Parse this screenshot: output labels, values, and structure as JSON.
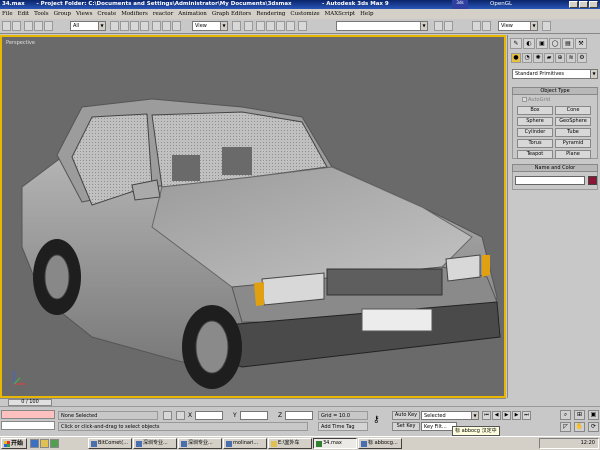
{
  "window": {
    "filename": "34.max",
    "project_folder": "- Project Folder: C:\\Documents and Settings\\Administrator\\My Documents\\3dsmax",
    "app_title": "- Autodesk 3ds Max 9",
    "logo_text": "3ds",
    "renderer": "OpenGL"
  },
  "menu": [
    "File",
    "Edit",
    "Tools",
    "Group",
    "Views",
    "Create",
    "Modifiers",
    "reactor",
    "Animation",
    "Graph Editors",
    "Rendering",
    "Customize",
    "MAXScript",
    "Help"
  ],
  "toolbar": {
    "selection_filter": "All",
    "ref_coord": "View",
    "view_right": "View"
  },
  "viewport": {
    "label": "Perspective",
    "accent": "#e8b800"
  },
  "command_panel": {
    "tabs": [
      "✎",
      "◐",
      "▣",
      "◯",
      "▤",
      "⚒"
    ],
    "category": "Standard Primitives",
    "object_type_title": "Object Type",
    "autogrid": "AutoGrid",
    "primitives": [
      "Box",
      "Cone",
      "Sphere",
      "GeoSphere",
      "Cylinder",
      "Tube",
      "Torus",
      "Pyramid",
      "Teapot",
      "Plane"
    ],
    "name_color_title": "Name and Color",
    "object_color": "#8c1436"
  },
  "timeline": {
    "frame": "0 / 100"
  },
  "status": {
    "selection": "None Selected",
    "prompt": "Click or click-and-drag to select objects",
    "x_label": "X",
    "y_label": "Y",
    "z_label": "Z",
    "grid": "Grid = 10.0",
    "add_time_tag": "Add Time Tag",
    "auto_key": "Auto Key",
    "set_key": "Set Key",
    "key_mode": "Selected",
    "key_filters": "Key Filt..."
  },
  "ime_tooltip": "标 abbocg 汉定中",
  "taskbar": {
    "start": "开始",
    "items": [
      "BitComet(...",
      "深圳专业...",
      "深圳专业...",
      "molinari...",
      "E:\\室外车",
      "34.max",
      "标 abbocg..."
    ],
    "clock": "12:20"
  }
}
